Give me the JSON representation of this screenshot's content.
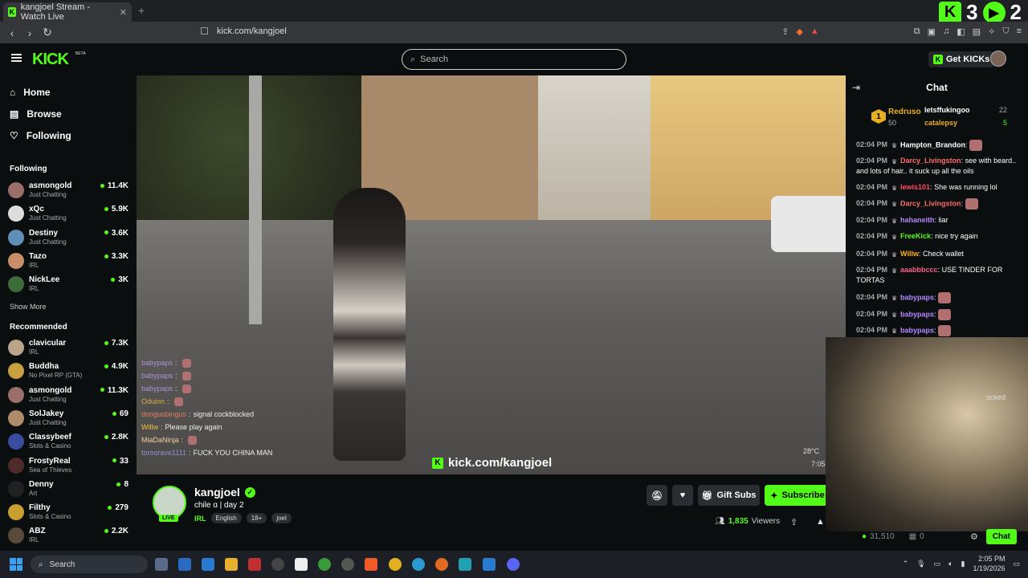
{
  "browser": {
    "tab_title": "kangjoel Stream - Watch Live",
    "url": "kick.com/kangjoel",
    "overlay_counts": [
      "3",
      "2"
    ]
  },
  "header": {
    "logo": "KICK",
    "beta": "BETA",
    "search_placeholder": "Search",
    "get_kicks": "Get KICKs"
  },
  "sidebar": {
    "nav": [
      "Home",
      "Browse",
      "Following"
    ],
    "following_heading": "Following",
    "following": [
      {
        "name": "asmongold",
        "category": "Just Chatting",
        "viewers": "11.4K",
        "color": "#9a6f6a"
      },
      {
        "name": "xQc",
        "category": "Just Chatting",
        "viewers": "5.9K",
        "color": "#dddddd"
      },
      {
        "name": "Destiny",
        "category": "Just Chatting",
        "viewers": "3.6K",
        "color": "#5d8fb8"
      },
      {
        "name": "Tazo",
        "category": "IRL",
        "viewers": "3.3K",
        "color": "#c98d6a"
      },
      {
        "name": "NickLee",
        "category": "IRL",
        "viewers": "3K",
        "color": "#3d6b3a"
      }
    ],
    "show_more": "Show More",
    "recommended_heading": "Recommended",
    "recommended": [
      {
        "name": "clavicular",
        "category": "IRL",
        "viewers": "7.3K",
        "color": "#b9a48a"
      },
      {
        "name": "Buddha",
        "category": "No Pixel RP (GTA)",
        "viewers": "4.9K",
        "color": "#c8a040"
      },
      {
        "name": "asmongold",
        "category": "Just Chatting",
        "viewers": "11.3K",
        "color": "#9a6f6a"
      },
      {
        "name": "SolJakey",
        "category": "Just Chatting",
        "viewers": "69",
        "color": "#b08a6c"
      },
      {
        "name": "Classybeef",
        "category": "Slots & Casino",
        "viewers": "2.8K",
        "color": "#3a4ca0"
      },
      {
        "name": "FrostyReal",
        "category": "Sea of Thieves",
        "viewers": "33",
        "color": "#4e2a2a"
      },
      {
        "name": "Denny",
        "category": "Art",
        "viewers": "8",
        "color": "#222222"
      },
      {
        "name": "Filthy",
        "category": "Slots & Casino",
        "viewers": "279",
        "color": "#c8a030"
      },
      {
        "name": "ABZ",
        "category": "IRL",
        "viewers": "2.2K",
        "color": "#5a4a3a"
      }
    ]
  },
  "video": {
    "overlay_chat": [
      {
        "user": "babypaps",
        "text": "",
        "color": "#b090d8"
      },
      {
        "user": "babypaps",
        "text": "",
        "color": "#b090d8"
      },
      {
        "user": "babypaps",
        "text": "",
        "color": "#b090d8"
      },
      {
        "user": "Oduinn",
        "text": "",
        "color": "#d8b040"
      },
      {
        "user": "dongusbingus",
        "text": "signal cockblocked",
        "color": "#e08060"
      },
      {
        "user": "Willw",
        "text": "Please play again",
        "color": "#f0c040"
      },
      {
        "user": "MiaDaNinja",
        "text": "",
        "color": "#f0d0a0"
      },
      {
        "user": "toroorave1111",
        "text": "FUCK YOU CHINA MAN",
        "color": "#9090d0"
      }
    ],
    "watermark": "kick.com/kangjoel",
    "weather": "28°C",
    "time": "7:05"
  },
  "stream": {
    "name": "kangjoel",
    "title": "chile ɑ | day 2",
    "category": "IRL",
    "tags": [
      "English",
      "18+",
      "joel"
    ],
    "live": "LIVE",
    "gift_subs": "Gift Subs",
    "subscribe": "Subscribe",
    "viewers": "1,835",
    "viewers_label": "Viewers"
  },
  "chat": {
    "title": "Chat",
    "leaderboard": [
      {
        "rank": "1",
        "name": "Redruso",
        "amount": "50"
      },
      {
        "name": "letsffukingoo",
        "amount": "22"
      },
      {
        "name": "catalepsy",
        "amount": "5"
      }
    ],
    "messages": [
      {
        "time": "02:04 PM",
        "user": "Hampton_Brandon",
        "text": "",
        "color": "#ffffff"
      },
      {
        "time": "02:04 PM",
        "user": "Darcy_Livingston",
        "text": "see with beard.. and lots of hair.. it suck up all the oils",
        "color": "#ff6b6b"
      },
      {
        "time": "02:04 PM",
        "user": "lewis101",
        "text": "She was running lol",
        "color": "#ff4d6a"
      },
      {
        "time": "02:04 PM",
        "user": "Darcy_Livingston",
        "text": "",
        "color": "#ff6b6b"
      },
      {
        "time": "02:04 PM",
        "user": "hahaneith",
        "text": "liar",
        "color": "#b388ff"
      },
      {
        "time": "02:04 PM",
        "user": "FreeKick",
        "text": "nice try again",
        "color": "#53fc18"
      },
      {
        "time": "02:04 PM",
        "user": "Willw",
        "text": "Check wallet",
        "color": "#ffb020"
      },
      {
        "time": "02:04 PM",
        "user": "aaabbbccc",
        "text": "USE TINDER FOR TORTAS",
        "color": "#ff5f8a"
      },
      {
        "time": "02:04 PM",
        "user": "babypaps",
        "text": "",
        "color": "#b388ff"
      },
      {
        "time": "02:04 PM",
        "user": "babypaps",
        "text": "",
        "color": "#b388ff"
      },
      {
        "time": "02:04 PM",
        "user": "babypaps",
        "text": "",
        "color": "#b388ff"
      },
      {
        "time": "02:04 PM",
        "user": "",
        "text": "",
        "color": "#b388ff"
      }
    ],
    "points": "31,510",
    "points2": "0",
    "chat_button": "Chat",
    "webcam_text": "ocked"
  },
  "taskbar": {
    "search": "Search",
    "time": "2:05 PM",
    "date": "1/19/2026"
  }
}
